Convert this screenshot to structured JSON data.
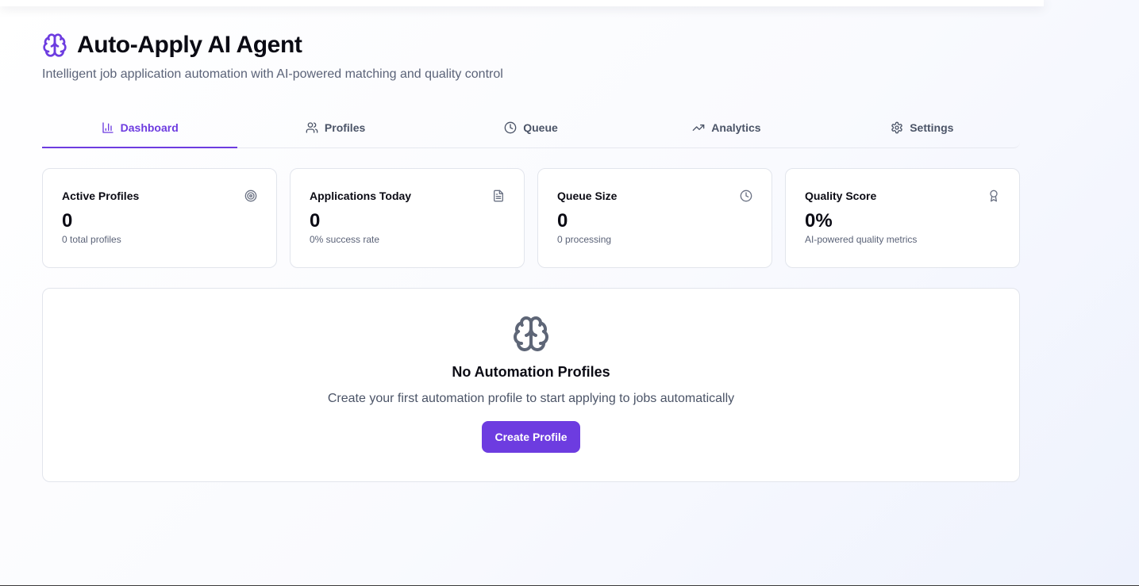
{
  "header": {
    "title": "Auto-Apply AI Agent",
    "subtitle": "Intelligent job application automation with AI-powered matching and quality control",
    "icon": "brain-icon",
    "accent": "#6d3ce0"
  },
  "tabs": [
    {
      "label": "Dashboard",
      "icon": "bar-chart-icon",
      "active": true
    },
    {
      "label": "Profiles",
      "icon": "users-icon",
      "active": false
    },
    {
      "label": "Queue",
      "icon": "clock-icon",
      "active": false
    },
    {
      "label": "Analytics",
      "icon": "trending-up-icon",
      "active": false
    },
    {
      "label": "Settings",
      "icon": "gear-icon",
      "active": false
    }
  ],
  "stats": [
    {
      "label": "Active Profiles",
      "value": "0",
      "sub": "0 total profiles",
      "icon": "target-icon"
    },
    {
      "label": "Applications Today",
      "value": "0",
      "sub": "0% success rate",
      "icon": "document-icon"
    },
    {
      "label": "Queue Size",
      "value": "0",
      "sub": "0 processing",
      "icon": "clock-icon"
    },
    {
      "label": "Quality Score",
      "value": "0%",
      "sub": "AI-powered quality metrics",
      "icon": "award-icon"
    }
  ],
  "empty_state": {
    "icon": "brain-icon",
    "title": "No Automation Profiles",
    "description": "Create your first automation profile to start applying to jobs automatically",
    "button_label": "Create Profile"
  }
}
